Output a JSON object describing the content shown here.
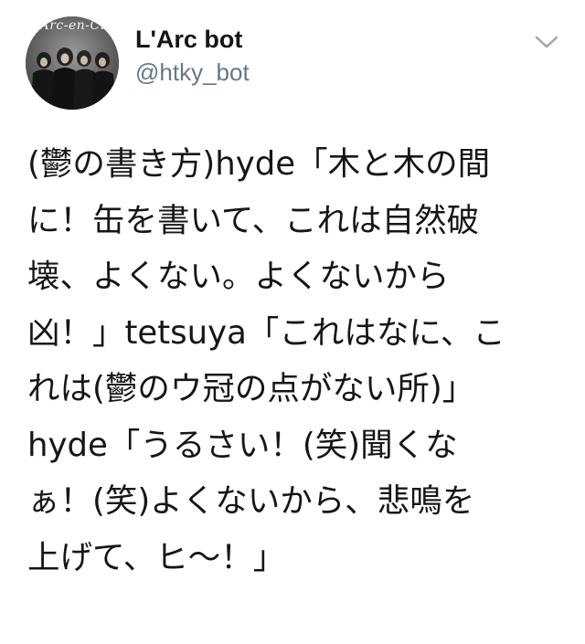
{
  "tweet": {
    "avatar": {
      "caption": "L'Arc-en-Ciel"
    },
    "user": {
      "display_name": "L'Arc bot",
      "handle": "@htky_bot"
    },
    "menu_icon": "chevron-down-icon",
    "text_lines": [
      "(鬱の書き方)hyde「木と木の間",
      "に！缶を書いて、これは自然破",
      "壊、よくない。よくないから",
      "凶！」tetsuya「これはなに、こ",
      "れは(鬱のウ冠の点がない所)」",
      "hyde「うるさい！(笑)聞くな",
      "ぁ！(笑)よくないから、悲鳴を",
      "上げて、ヒ〜！」"
    ]
  },
  "colors": {
    "text": "#14171a",
    "handle": "#657786",
    "caret": "#a0a4a8"
  }
}
